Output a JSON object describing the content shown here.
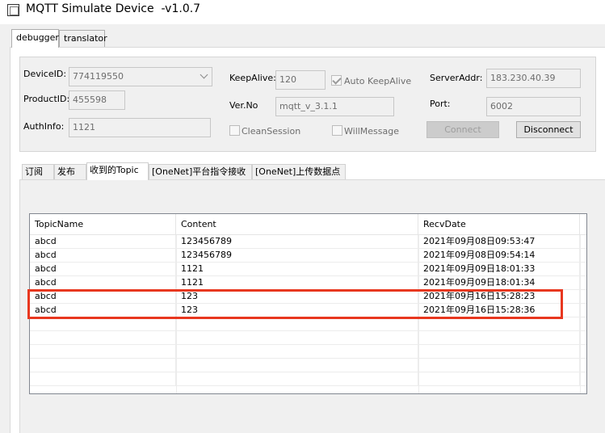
{
  "window": {
    "title": "MQTT Simulate Device  -v1.0.7"
  },
  "outer_tabs": [
    {
      "label": "debugger",
      "active": true
    },
    {
      "label": "translator",
      "active": false
    }
  ],
  "settings": {
    "device_id": {
      "label": "DeviceID:",
      "value": "774119550"
    },
    "product_id": {
      "label": "ProductID:",
      "value": "455598"
    },
    "auth_info": {
      "label": "AuthInfo:",
      "value": "1121"
    },
    "keep_alive": {
      "label": "KeepAlive:",
      "value": "120"
    },
    "auto_keep_alive": {
      "label": "Auto KeepAlive",
      "checked": true
    },
    "ver_no": {
      "label": "Ver.No",
      "value": "mqtt_v_3.1.1"
    },
    "clean_session": {
      "label": "CleanSession",
      "checked": false
    },
    "will_message": {
      "label": "WillMessage",
      "checked": false
    },
    "server_addr": {
      "label": "ServerAddr:",
      "value": "183.230.40.39"
    },
    "port": {
      "label": "Port:",
      "value": "6002"
    },
    "connect_label": "Connect",
    "disconnect_label": "Disconnect"
  },
  "inner_tabs": [
    {
      "label": "订阅",
      "active": false
    },
    {
      "label": "发布",
      "active": false
    },
    {
      "label": "收到的Topic",
      "active": true
    },
    {
      "label": "[OneNet]平台指令接收",
      "active": false
    },
    {
      "label": "[OneNet]上传数据点",
      "active": false
    }
  ],
  "table": {
    "columns": [
      "TopicName",
      "Content",
      "RecvDate"
    ],
    "rows": [
      [
        "abcd",
        "123456789",
        "2021年09月08日09:53:47"
      ],
      [
        "abcd",
        "123456789",
        "2021年09月08日09:54:14"
      ],
      [
        "abcd",
        "1121",
        "2021年09月09日18:01:33"
      ],
      [
        "abcd",
        "1121",
        "2021年09月09日18:01:34"
      ],
      [
        "abcd",
        "123",
        "2021年09月16日15:28:23"
      ],
      [
        "abcd",
        "123",
        "2021年09月16日15:28:36"
      ]
    ],
    "empty_rows": 5
  },
  "colors": {
    "highlight": "#e8371f"
  }
}
